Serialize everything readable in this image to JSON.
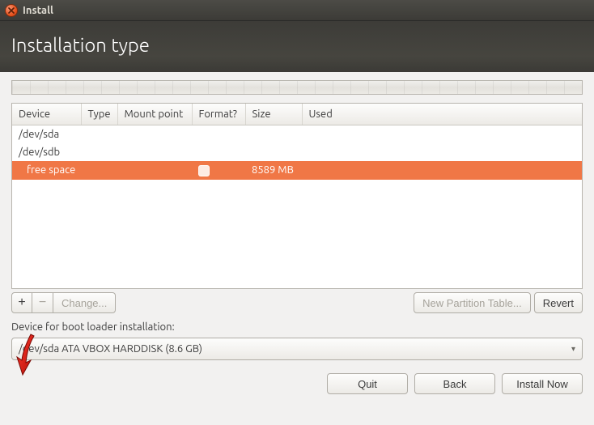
{
  "window": {
    "title": "Install"
  },
  "page": {
    "title": "Installation type"
  },
  "table": {
    "columns": {
      "device": "Device",
      "type": "Type",
      "mount": "Mount point",
      "format": "Format?",
      "size": "Size",
      "used": "Used"
    },
    "rows": [
      {
        "device": "/dev/sda",
        "type": "",
        "mount": "",
        "format": "",
        "size": "",
        "used": "",
        "selected": false,
        "indent": false
      },
      {
        "device": "/dev/sdb",
        "type": "",
        "mount": "",
        "format": "",
        "size": "",
        "used": "",
        "selected": false,
        "indent": false
      },
      {
        "device": "free space",
        "type": "",
        "mount": "",
        "format": "checkbox",
        "size": "8589 MB",
        "used": "",
        "selected": true,
        "indent": true
      }
    ]
  },
  "toolbar": {
    "add": "+",
    "remove": "−",
    "change": "Change...",
    "new_table": "New Partition Table...",
    "revert": "Revert"
  },
  "bootloader": {
    "label": "Device for boot loader installation:",
    "value": "/dev/sda   ATA VBOX HARDDISK (8.6 GB)"
  },
  "footer": {
    "quit": "Quit",
    "back": "Back",
    "install": "Install Now"
  }
}
